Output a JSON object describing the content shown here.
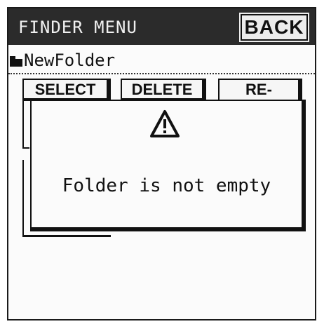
{
  "header": {
    "title": "FINDER MENU",
    "back_label": "BACK"
  },
  "path": {
    "icon": "folder-icon",
    "name": "NewFolder"
  },
  "toolbar": {
    "select_label": "SELECT",
    "delete_label": "DELETE",
    "rename_label": "RE-"
  },
  "dialog": {
    "icon": "warning-icon",
    "message": "Folder is not empty"
  },
  "colors": {
    "titlebar": "#2b2b2b",
    "title_text": "#f0f0f0",
    "border": "#111111",
    "screen": "#fbfbfb"
  }
}
